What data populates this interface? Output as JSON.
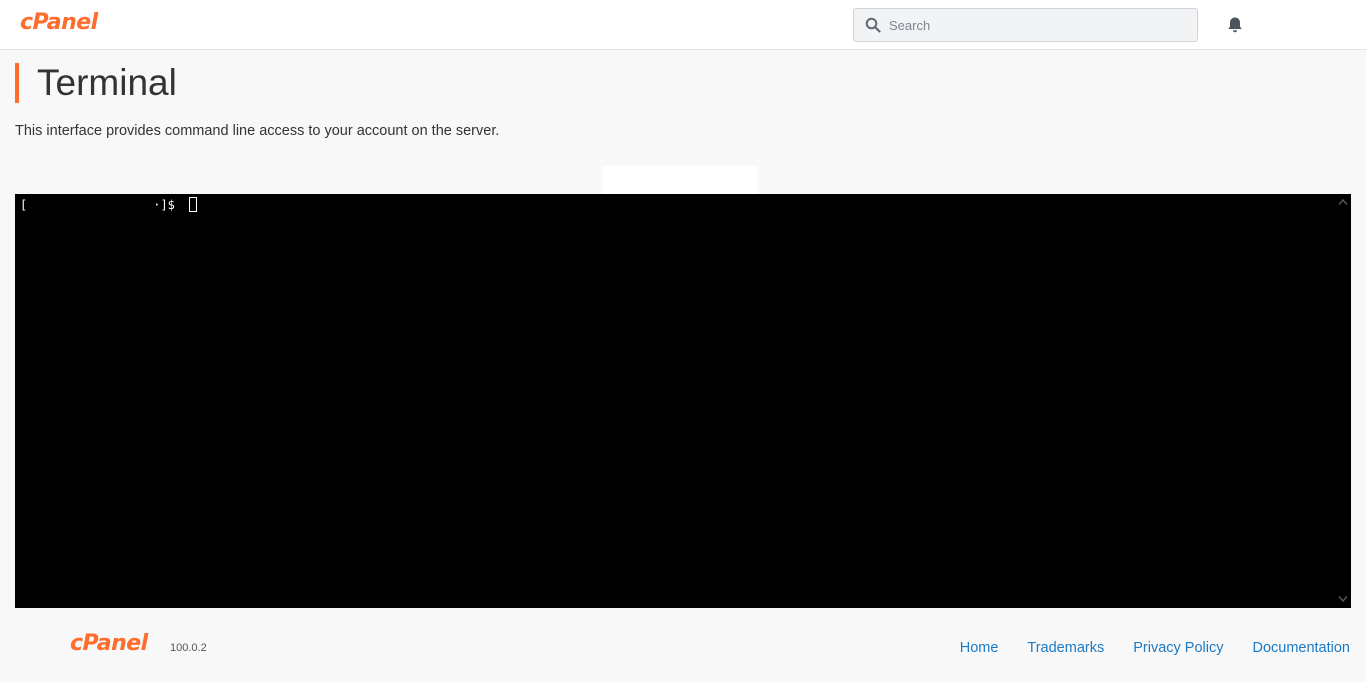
{
  "header": {
    "logo_text": "cPanel",
    "search_placeholder": "Search",
    "brand_color": "#ff6c2c",
    "icons": [
      "search-icon",
      "bell-icon"
    ]
  },
  "page": {
    "title": "Terminal",
    "description": "This interface provides command line access to your account on the server."
  },
  "terminal": {
    "prompt_start": "[",
    "prompt_end": "·]$",
    "background": "#000000"
  },
  "footer": {
    "logo_text": "cPanel",
    "version": "100.0.2",
    "links": [
      "Home",
      "Trademarks",
      "Privacy Policy",
      "Documentation"
    ],
    "link_color": "#1d7ac3"
  }
}
